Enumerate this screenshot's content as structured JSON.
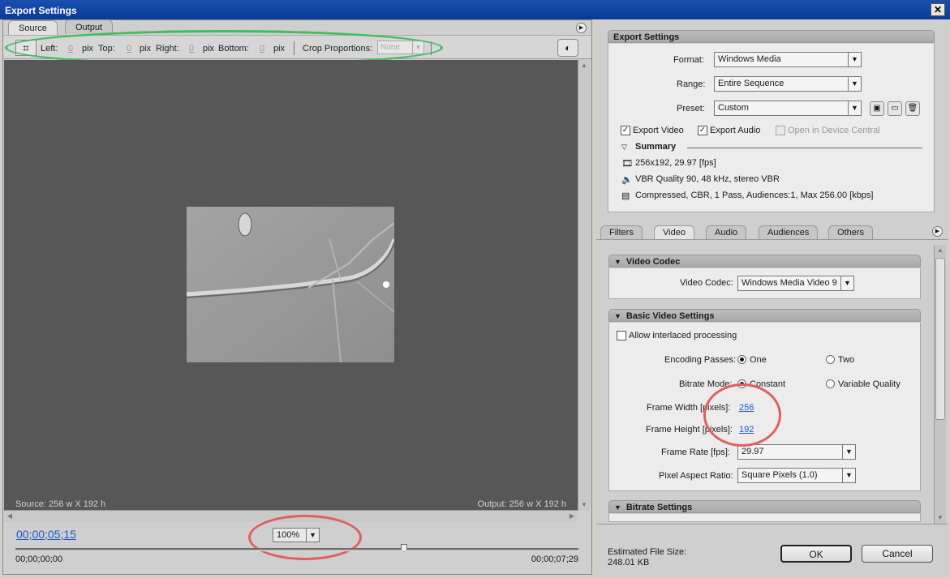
{
  "window": {
    "title": "Export Settings",
    "close_glyph": "✕"
  },
  "left": {
    "tabs": [
      "Source",
      "Output"
    ],
    "crop": {
      "left_label": "Left:",
      "left_value": "0",
      "unit": "pix",
      "top_label": "Top:",
      "top_value": "0",
      "right_label": "Right:",
      "right_value": "0",
      "bottom_label": "Bottom:",
      "bottom_value": "0",
      "proportions_label": "Crop Proportions:",
      "proportions_value": "None"
    },
    "source_info": "Source: 256 w X 192 h",
    "output_info": "Output: 256 w X 192 h",
    "current_timecode": "00;00;05;15",
    "zoom": "100%",
    "start_timecode": "00;00;00;00",
    "end_timecode": "00;00;07;29",
    "playhead_fraction": 0.69
  },
  "export": {
    "header": "Export Settings",
    "format_label": "Format:",
    "format_value": "Windows Media",
    "range_label": "Range:",
    "range_value": "Entire Sequence",
    "preset_label": "Preset:",
    "preset_value": "Custom",
    "export_video": "Export Video",
    "export_audio": "Export Audio",
    "open_device_central": "Open in Device Central",
    "summary_label": "Summary",
    "summary_video": "256x192, 29.97 [fps]",
    "summary_audio": "VBR Quality 90, 48 kHz, stereo VBR",
    "summary_bitrate": "Compressed, CBR, 1 Pass, Audiences:1, Max 256.00 [kbps]"
  },
  "tabs": [
    "Filters",
    "Video",
    "Audio",
    "Audiences",
    "Others"
  ],
  "video_codec": {
    "header": "Video Codec",
    "label": "Video Codec:",
    "value": "Windows Media Video 9"
  },
  "basic_video": {
    "header": "Basic Video Settings",
    "interlaced": "Allow interlaced processing",
    "passes_label": "Encoding Passes:",
    "passes_one": "One",
    "passes_two": "Two",
    "bitrate_label": "Bitrate Mode:",
    "bitrate_constant": "Constant",
    "bitrate_variable": "Variable Quality",
    "width_label": "Frame Width [pixels]:",
    "width_value": "256",
    "height_label": "Frame Height [pixels]:",
    "height_value": "192",
    "fps_label": "Frame Rate [fps]:",
    "fps_value": "29.97",
    "par_label": "Pixel Aspect Ratio:",
    "par_value": "Square Pixels (1.0)"
  },
  "bitrate_settings": {
    "header": "Bitrate Settings"
  },
  "footer": {
    "estimated_label": "Estimated File Size:",
    "estimated_value": "248.01 KB",
    "ok": "OK",
    "cancel": "Cancel"
  },
  "colors": {
    "accent_link": "#1a5bc7",
    "annotation_green": "#3fbf5c",
    "annotation_red": "#e06060"
  }
}
